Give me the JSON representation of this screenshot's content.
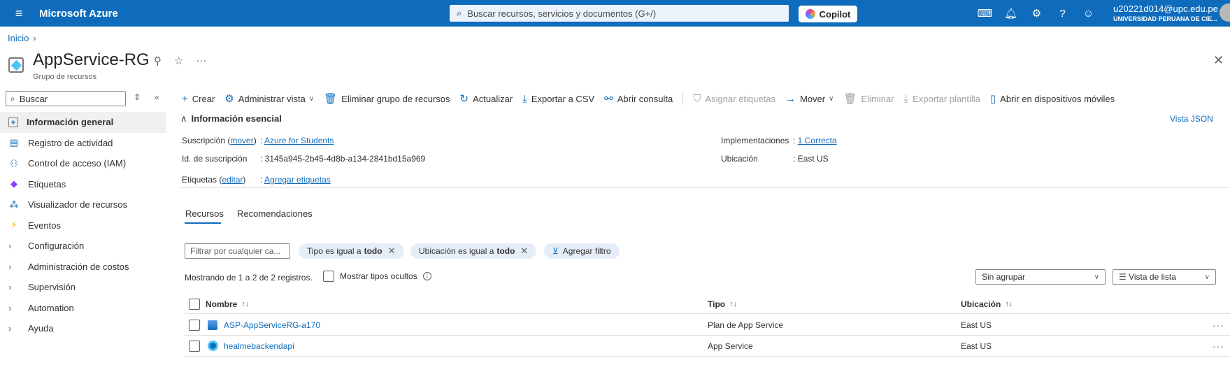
{
  "topbar": {
    "brand": "Microsoft Azure",
    "search_placeholder": "Buscar recursos, servicios y documentos (G+/)",
    "copilot_label": "Copilot",
    "account_email": "u20221d014@upc.edu.pe",
    "account_org": "UNIVERSIDAD PERUANA DE CIE...",
    "icons": [
      "cloud-shell-icon",
      "bell-icon",
      "gear-icon",
      "help-icon",
      "feedback-icon"
    ]
  },
  "breadcrumb": {
    "home": "Inicio"
  },
  "header": {
    "title": "AppService-RG",
    "subtitle": "Grupo de recursos"
  },
  "sidebar": {
    "search_placeholder": "Buscar",
    "items": [
      {
        "label": "Información general",
        "icon": "overview-icon",
        "active": true
      },
      {
        "label": "Registro de actividad",
        "icon": "activity-log-icon"
      },
      {
        "label": "Control de acceso (IAM)",
        "icon": "iam-icon"
      },
      {
        "label": "Etiquetas",
        "icon": "tag-icon"
      },
      {
        "label": "Visualizador de recursos",
        "icon": "resource-visualizer-icon"
      },
      {
        "label": "Eventos",
        "icon": "events-icon"
      },
      {
        "label": "Configuración",
        "icon": "chevron-right-icon"
      },
      {
        "label": "Administración de costos",
        "icon": "chevron-right-icon"
      },
      {
        "label": "Supervisión",
        "icon": "chevron-right-icon"
      },
      {
        "label": "Automation",
        "icon": "chevron-right-icon"
      },
      {
        "label": "Ayuda",
        "icon": "chevron-right-icon"
      }
    ]
  },
  "toolbar": {
    "create": "Crear",
    "manage_view": "Administrar vista",
    "delete_rg": "Eliminar grupo de recursos",
    "refresh": "Actualizar",
    "export_csv": "Exportar a CSV",
    "open_query": "Abrir consulta",
    "assign_tags": "Asignar etiquetas",
    "move": "Mover",
    "delete": "Eliminar",
    "export_template": "Exportar plantilla",
    "open_mobile": "Abrir en dispositivos móviles"
  },
  "essentials": {
    "heading": "Información esencial",
    "json_view": "Vista JSON",
    "subscription_label": "Suscripción",
    "subscription_move": "mover",
    "subscription_value": "Azure for Students",
    "subscription_id_label": "Id. de suscripción",
    "subscription_id_value": "3145a945-2b45-4d8b-a134-2841bd15a969",
    "tags_label": "Etiquetas",
    "tags_edit": "editar",
    "tags_value": "Agregar etiquetas",
    "deployments_label": "Implementaciones",
    "deployments_value": "1 Correcta",
    "location_label": "Ubicación",
    "location_value": "East US"
  },
  "tabs": [
    "Recursos",
    "Recomendaciones"
  ],
  "filters": {
    "filter_placeholder": "Filtrar por cualquier ca...",
    "type_pill_prefix": "Tipo es igual a",
    "type_pill_value": "todo",
    "location_pill_prefix": "Ubicación es igual a",
    "location_pill_value": "todo",
    "add_filter": "Agregar filtro"
  },
  "listing": {
    "showing": "Mostrando de 1 a 2 de 2 registros.",
    "show_hidden": "Mostrar tipos ocultos",
    "group_by": "Sin agrupar",
    "view_mode": "Vista de lista"
  },
  "table": {
    "columns": [
      "Nombre",
      "Tipo",
      "Ubicación"
    ],
    "rows": [
      {
        "name": "ASP-AppServiceRG-a170",
        "type": "Plan de App Service",
        "location": "East US",
        "icon": "app-service-plan-icon"
      },
      {
        "name": "healmebackendapi",
        "type": "App Service",
        "location": "East US",
        "icon": "app-service-icon"
      }
    ]
  }
}
